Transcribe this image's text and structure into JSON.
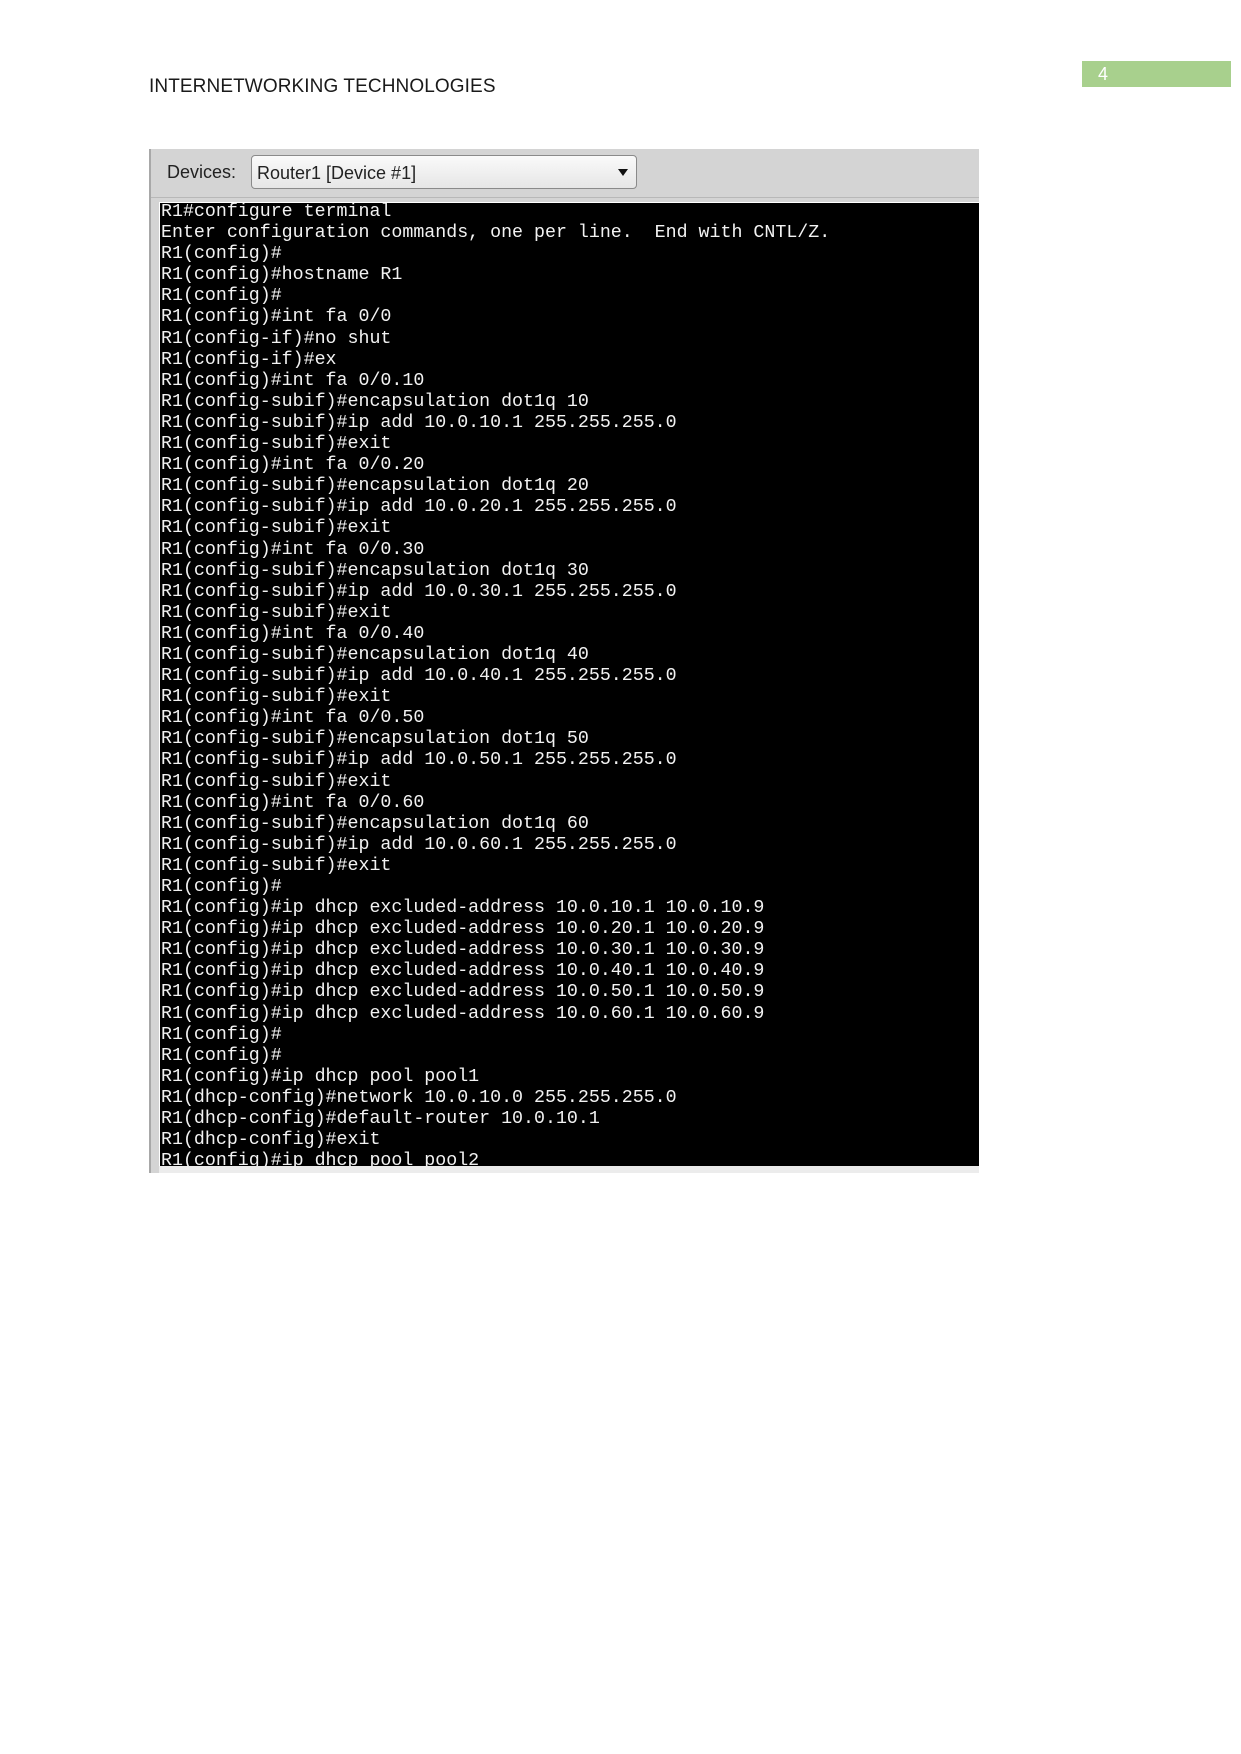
{
  "document": {
    "header_title": "INTERNETWORKING TECHNOLOGIES",
    "page_number": "4",
    "colors": {
      "page_badge": "#a8d08d",
      "terminal_bg": "#000000",
      "terminal_text": "#f2f2f2"
    }
  },
  "device_panel": {
    "devices_label": "Devices:",
    "selected_device": "Router1 [Device #1]",
    "dropdown_icon": "chevron-down-icon"
  },
  "terminal": {
    "lines": [
      "R1#configure terminal",
      "Enter configuration commands, one per line.  End with CNTL/Z.",
      "R1(config)#",
      "R1(config)#hostname R1",
      "R1(config)#",
      "R1(config)#int fa 0/0",
      "R1(config-if)#no shut",
      "R1(config-if)#ex",
      "R1(config)#int fa 0/0.10",
      "R1(config-subif)#encapsulation dot1q 10",
      "R1(config-subif)#ip add 10.0.10.1 255.255.255.0",
      "R1(config-subif)#exit",
      "R1(config)#int fa 0/0.20",
      "R1(config-subif)#encapsulation dot1q 20",
      "R1(config-subif)#ip add 10.0.20.1 255.255.255.0",
      "R1(config-subif)#exit",
      "R1(config)#int fa 0/0.30",
      "R1(config-subif)#encapsulation dot1q 30",
      "R1(config-subif)#ip add 10.0.30.1 255.255.255.0",
      "R1(config-subif)#exit",
      "R1(config)#int fa 0/0.40",
      "R1(config-subif)#encapsulation dot1q 40",
      "R1(config-subif)#ip add 10.0.40.1 255.255.255.0",
      "R1(config-subif)#exit",
      "R1(config)#int fa 0/0.50",
      "R1(config-subif)#encapsulation dot1q 50",
      "R1(config-subif)#ip add 10.0.50.1 255.255.255.0",
      "R1(config-subif)#exit",
      "R1(config)#int fa 0/0.60",
      "R1(config-subif)#encapsulation dot1q 60",
      "R1(config-subif)#ip add 10.0.60.1 255.255.255.0",
      "R1(config-subif)#exit",
      "R1(config)#",
      "R1(config)#ip dhcp excluded-address 10.0.10.1 10.0.10.9",
      "R1(config)#ip dhcp excluded-address 10.0.20.1 10.0.20.9",
      "R1(config)#ip dhcp excluded-address 10.0.30.1 10.0.30.9",
      "R1(config)#ip dhcp excluded-address 10.0.40.1 10.0.40.9",
      "R1(config)#ip dhcp excluded-address 10.0.50.1 10.0.50.9",
      "R1(config)#ip dhcp excluded-address 10.0.60.1 10.0.60.9",
      "R1(config)#",
      "R1(config)#",
      "R1(config)#ip dhcp pool pool1",
      "R1(dhcp-config)#network 10.0.10.0 255.255.255.0",
      "R1(dhcp-config)#default-router 10.0.10.1",
      "R1(dhcp-config)#exit",
      "R1(config)#ip dhcp pool pool2"
    ]
  }
}
